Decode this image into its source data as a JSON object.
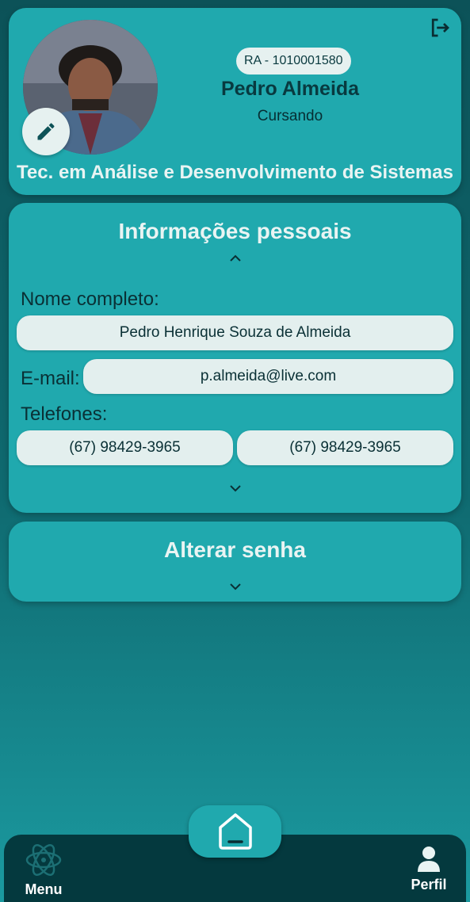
{
  "profile": {
    "ra_badge": "RA - 1010001580",
    "name": "Pedro Almeida",
    "status": "Cursando",
    "course": "Tec. em Análise e Desenvolvimento de Sistemas"
  },
  "personal_info": {
    "title": "Informações pessoais",
    "full_name_label": "Nome completo:",
    "full_name_value": "Pedro Henrique Souza de Almeida",
    "email_label": "E-mail:",
    "email_value": "p.almeida@live.com",
    "phones_label": "Telefones:",
    "phones": [
      "(67) 98429-3965",
      "(67) 98429-3965"
    ]
  },
  "password": {
    "title": "Alterar senha"
  },
  "nav": {
    "menu_label": "Menu",
    "profile_label": "Perfil"
  },
  "colors": {
    "card": "#20a9ae",
    "nav_bar": "#04393e",
    "pill": "#e3efee",
    "title_text": "#e9f4f3"
  },
  "icons": [
    "logout-icon",
    "pencil-icon",
    "chevron-up-icon",
    "chevron-down-icon",
    "atom-icon",
    "home-icon",
    "user-icon"
  ]
}
